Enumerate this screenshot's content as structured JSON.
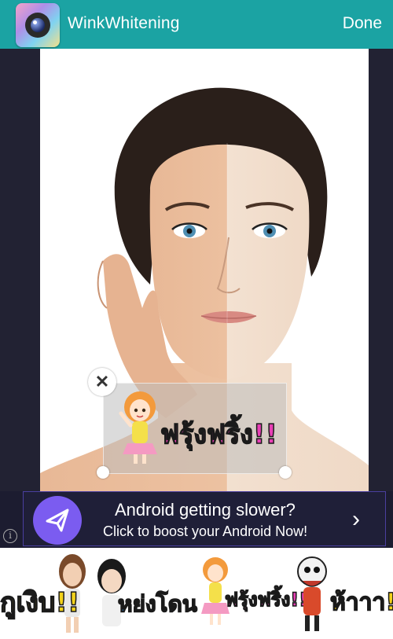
{
  "app": {
    "title": "WinkWhitening",
    "done_label": "Done",
    "icon": "camera-lens-icon"
  },
  "editor": {
    "photo": "face-portrait-before-after",
    "sticker": {
      "caption": "ฟรุ้งฟริ้ง!!",
      "icon": "anime-girl-sticker"
    }
  },
  "ad": {
    "title": "Android getting slower?",
    "subtitle": "Click to boost your Android Now!",
    "logo_icon": "paper-plane-icon",
    "chevron_icon": "chevron-right-icon",
    "info_icon": "info-icon",
    "info_glyph": "i",
    "chevron_glyph": "›"
  },
  "sticker_strip": {
    "items": [
      {
        "text": "กูเงิบ!!",
        "color": "#f3d21a"
      },
      {
        "text": "หย่งโดน",
        "color": "#2f8be0"
      },
      {
        "text": "ฟรุ้งฟริ้ง!!",
        "color": "#e83fb5"
      },
      {
        "text": "ห้าาา!!",
        "color": "#f3d21a"
      }
    ]
  },
  "colors": {
    "action_bar": "#1ba3a3",
    "background": "#222233",
    "ad_logo": "#7b5cf0"
  }
}
